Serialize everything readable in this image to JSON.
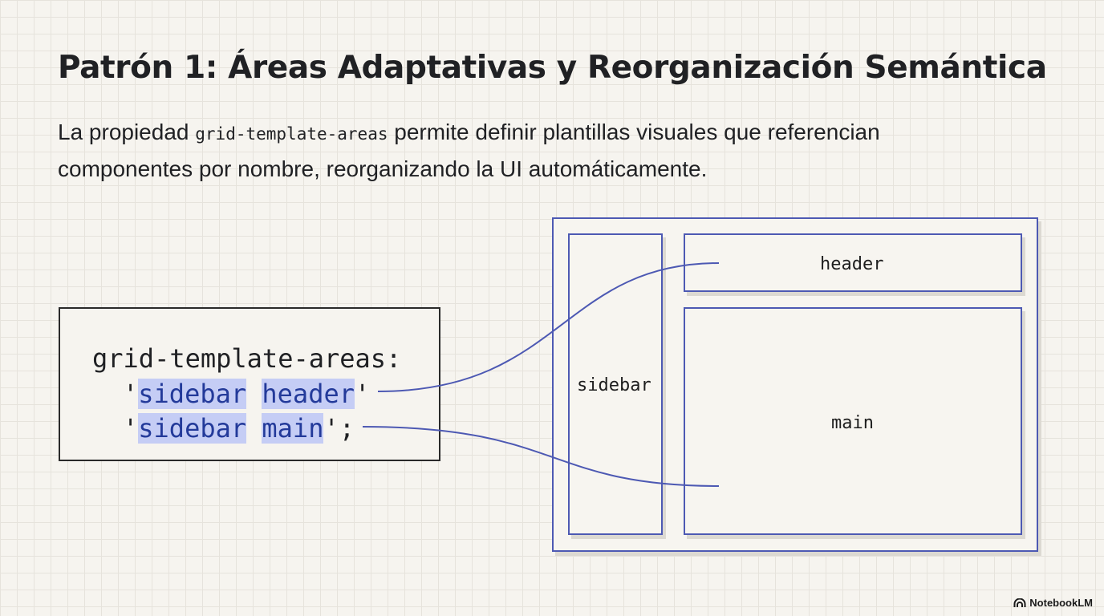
{
  "title": "Patrón 1: Áreas Adaptativas y Reorganización Semántica",
  "description": {
    "before": "La propiedad ",
    "code": "grid-template-areas",
    "after": " permite definir plantillas visuales que referencian componentes por nombre, reorganizando la UI automáticamente."
  },
  "code_block": {
    "line1": "grid-template-areas:",
    "line2": {
      "open": "'",
      "name1": "sidebar",
      "name2": "header",
      "close": "'"
    },
    "line3": {
      "open": "'",
      "name1": "sidebar",
      "name2": "main",
      "close": "';"
    }
  },
  "layout_diagram": {
    "sidebar_label": "sidebar",
    "header_label": "header",
    "main_label": "main"
  },
  "colors": {
    "accent": "#4d59b3",
    "highlight": "#c5cdf5",
    "background": "#f6f4ef"
  },
  "branding": {
    "logo_icon": "notebooklm-icon",
    "label": "NotebookLM"
  }
}
